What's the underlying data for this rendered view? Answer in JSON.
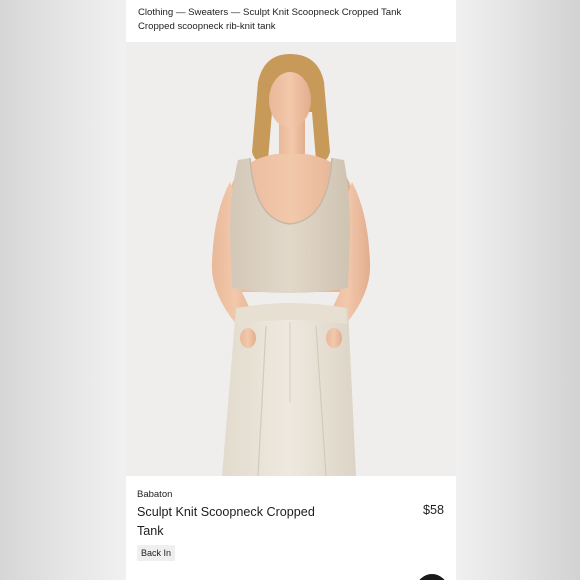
{
  "breadcrumb": {
    "path": "Clothing — Sweaters — Sculpt Knit Scoopneck Cropped Tank",
    "subtitle": "Cropped scoopneck rib-knit tank"
  },
  "product": {
    "brand": "Babaton",
    "title": "Sculpt Knit Scoopneck Cropped Tank",
    "price": "$58",
    "tag": "Back In"
  },
  "image": {
    "description": "product-photo-model-cropped-tank-cream-trousers",
    "colors": {
      "background": "#efeeec",
      "garment": "#ddd3c4",
      "trousers": "#eae4d8",
      "hair": "#c89a5a"
    }
  }
}
